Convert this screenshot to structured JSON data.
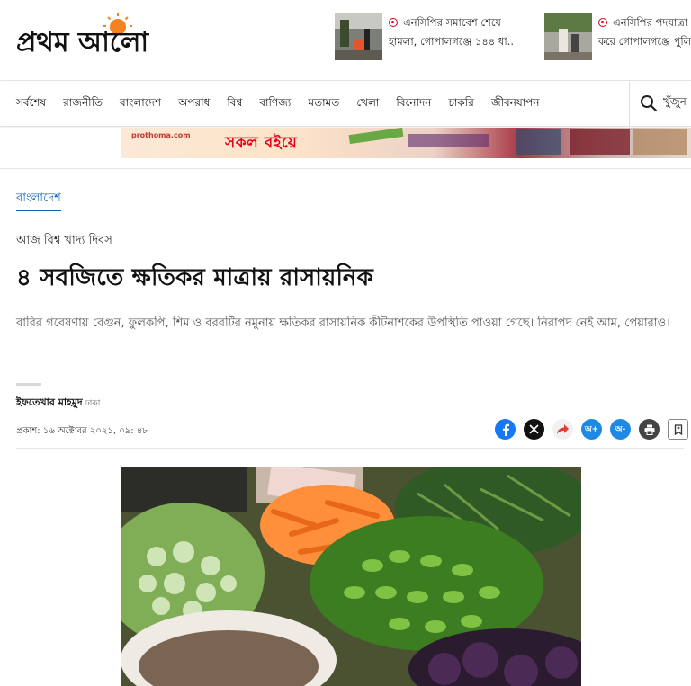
{
  "brand": {
    "logo_text": "প্রথম আলো",
    "accent_color": "#e3001b",
    "sun_color": "#f58220"
  },
  "header": {
    "news": [
      {
        "line1": "এনসিপির সমাবেশ শেষে",
        "line2": "হামলা, গোপালগঞ্জে ১৪৪ ধা..."
      },
      {
        "line1": "এনসিপির পদযাত্রা",
        "line2": "করে গোপালগঞ্জে পুলি"
      }
    ]
  },
  "nav": {
    "items": [
      "সর্বশেষ",
      "রাজনীতি",
      "বাংলাদেশ",
      "অপরাধ",
      "বিশ্ব",
      "বাণিজ্য",
      "মতামত",
      "খেলা",
      "বিনোদন",
      "চাকরি",
      "জীবনযাপন"
    ],
    "search_label": "খুঁজুন"
  },
  "ad": {
    "brand_small": "prothoma.com",
    "slogan": "সকল বইয়ে"
  },
  "article": {
    "section": "বাংলাদেশ",
    "kicker": "আজ বিশ্ব খাদ্য দিবস",
    "headline": "৪ সবজিতে ক্ষতিকর মাত্রায় রাসায়নিক",
    "summary": "বারির গবেষণায় বেগুন, ফুলকপি, শিম ও বরবটির নমুনায় ক্ষতিকর রাসায়নিক কীটনাশকের উপস্থিতি পাওয়া গেছে। নিরাপদ নেই আম, পেয়ারাও।",
    "author": "ইফতেখার মাহমুদ",
    "location": "ঢাকা",
    "published": "প্রকাশ: ১৬ অক্টোবর ২০২১, ০৯: ৪৮"
  },
  "share": {
    "buttons": [
      "facebook-icon",
      "x-icon",
      "share-icon",
      "font-increase-icon",
      "font-decrease-icon",
      "print-icon",
      "bookmark-icon"
    ],
    "font_increase_label": "অ+",
    "font_decrease_label": "অ-"
  }
}
